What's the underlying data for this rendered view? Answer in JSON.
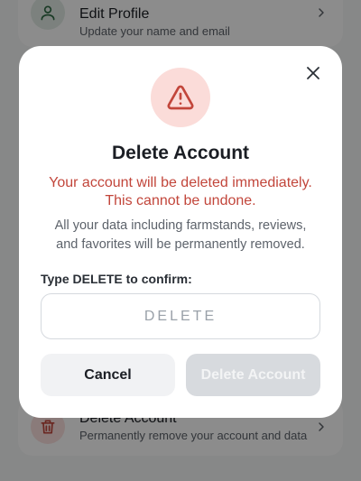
{
  "background": {
    "edit_profile": {
      "title": "Edit Profile",
      "subtitle": "Update your name and email",
      "icon": "user-icon"
    },
    "delete_account": {
      "title": "Delete Account",
      "subtitle": "Permanently remove your account and data",
      "icon": "trash-icon"
    }
  },
  "modal": {
    "icon": "warning-triangle-icon",
    "title": "Delete Account",
    "warning_line1": "Your account will be deleted immediately.",
    "warning_line2": "This cannot be undone.",
    "info_line1": "All your data including farmstands, reviews,",
    "info_line2": "and favorites will be permanently removed.",
    "confirm_label": "Type DELETE to confirm:",
    "confirm_input": {
      "value": "",
      "placeholder": "DELETE"
    },
    "cancel_label": "Cancel",
    "delete_label": "Delete Account",
    "delete_enabled": false
  },
  "colors": {
    "danger": "#c2463b",
    "danger_bg": "#fbdcd9",
    "disabled_button": "#d7dade",
    "overlay": "rgba(0,0,0,0.45)"
  }
}
